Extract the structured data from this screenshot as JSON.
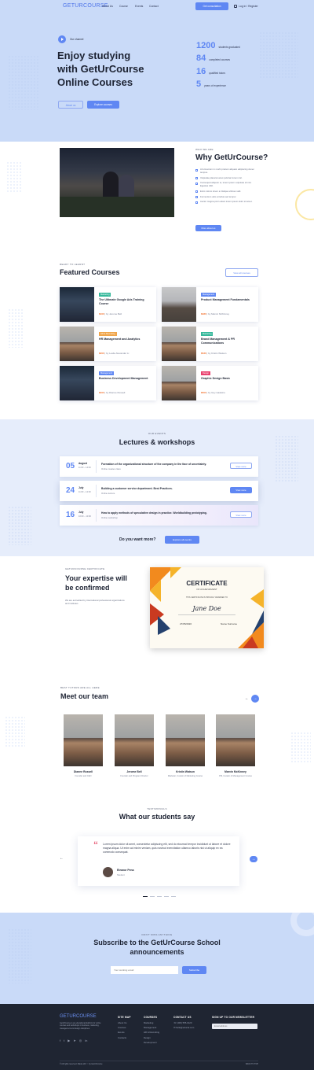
{
  "nav": {
    "logo": "GETURCOURSE",
    "links": [
      "About Us",
      "Course",
      "Events",
      "Contact"
    ],
    "cta": "Get consultation",
    "auth": "Log in / Register"
  },
  "hero": {
    "badge": "Our channel",
    "title_l1": "Enjoy studying",
    "title_l2": "with GetUrCourse",
    "title_l3": "Online Courses",
    "btn_secondary": "About us",
    "btn_primary": "Explore courses",
    "stats": [
      {
        "value": "1200",
        "label": "students graduated"
      },
      {
        "value": "84",
        "label": "completed courses"
      },
      {
        "value": "16",
        "label": "qualified tutors"
      },
      {
        "value": "5",
        "label": "years of experience"
      }
    ]
  },
  "why": {
    "eyebrow": "WHO WE ARE",
    "title": "Why GetUrCourse?",
    "items": [
      "A fermentum in morbi pretium aliquam adipiscing donec tempus.",
      "Vulputate placerat amet pulvinar lorem nisl.",
      "Consequat aliquam et, lorem ipsum vulputate sit nisi. Egestas nibh.",
      "Enim rutrum lorem a tristique ultrices velit.",
      "Fermentum odio at tellus sed tempor.",
      "Auctor magna proin etiam lorem ipsum dolor sit amet."
    ],
    "btn": "More about us"
  },
  "featured": {
    "eyebrow": "READY TO LEARN?",
    "title": "Featured Courses",
    "view_all": "View all courses",
    "courses": [
      {
        "tag": "Marketing",
        "tag_color": "#35b89b",
        "title": "The Ultimate Google Ads Training Course",
        "price": "$100",
        "author": "by Jerome Bell"
      },
      {
        "tag": "Management",
        "tag_color": "#5f87f3",
        "title": "Product Management Fundamentals",
        "price": "$480",
        "author": "by Marvin McKinney"
      },
      {
        "tag": "HR & Recruiting",
        "tag_color": "#f0a54a",
        "title": "HR Management and Analytics",
        "price": "$200",
        "author": "by Leslie Alexander Li"
      },
      {
        "tag": "Marketing",
        "tag_color": "#35b89b",
        "title": "Brand Management & PR Communications",
        "price": "$530",
        "author": "by Kristin Watson"
      },
      {
        "tag": "Management",
        "tag_color": "#5f87f3",
        "title": "Business Development Management",
        "price": "$400",
        "author": "by Dianne Russell"
      },
      {
        "tag": "Design",
        "tag_color": "#e9406e",
        "title": "Graphic Design Basic",
        "price": "$500",
        "author": "by Guy Hawkins"
      }
    ]
  },
  "events": {
    "eyebrow": "OUR EVENTS",
    "title": "Lectures & workshops",
    "items": [
      {
        "day": "05",
        "month": "August",
        "time": "11:00 – 14:00",
        "title": "Formation of the organizational structure of the company in the face of uncertainty.",
        "sub": "Online master-class",
        "btn": "View more"
      },
      {
        "day": "24",
        "month": "July",
        "time": "11:00 – 12:30",
        "title": "Building a customer service department. Best Practices.",
        "sub": "Online lecture",
        "btn": "View more"
      },
      {
        "day": "16",
        "month": "July",
        "time": "10:00 – 13:00",
        "title": "How to apply methods of speculative design in practice. Worldbuilding prototyping.",
        "sub": "Online workshop",
        "btn": "View more"
      }
    ],
    "more_q": "Do you want more?",
    "more_btn": "Explore all events"
  },
  "cert": {
    "eyebrow": "GETURCOURSE CERTIFICATE",
    "title_l1": "Your expertise will",
    "title_l2": "be confirmed",
    "desc": "We are accredited by international professional organizations and institutes",
    "c_title": "CERTIFICATE",
    "c_sub": "OF ACHIEVEMENT",
    "c_awarded": "THIS CERTIFICATE IS PROUDLY AWARDED TO",
    "c_name": "Jane Doe",
    "c_date": "27/05/2020",
    "c_sign": "Name Surname"
  },
  "team": {
    "eyebrow": "BEST TUTORS ARE ALL HERE",
    "title": "Meet our team",
    "members": [
      {
        "name": "Dianne Russell",
        "role": "Founder and CEO"
      },
      {
        "name": "Jerome Bell",
        "role": "Founder and Program Director"
      },
      {
        "name": "Kristin Watson",
        "role": "Marketer, Curator of Marketing Course"
      },
      {
        "name": "Marvin McKinney",
        "role": "PM, Curator of Management Course"
      }
    ]
  },
  "testimonials": {
    "eyebrow": "TESTIMONIALS",
    "title": "What our students say",
    "quote": "Lorem ipsum dolor sit amet, consectetur adipiscing elit, sed do eiusmod tempor incididunt ut labore et dolore magna aliqua. Ut enim ad minim veniam, quis nostrud exercitation ullamco laboris nisi ut aliquip ex ea commodo consequat.",
    "name": "Eleanor Pena",
    "role": "Student"
  },
  "subscribe": {
    "eyebrow": "DON'T MISS ANYTHING",
    "title_l1": "Subscribe to the GetUrCourse School",
    "title_l2": "announcements",
    "placeholder": "Your working email",
    "btn": "Subscribe"
  },
  "footer": {
    "logo": "GETURCOURSE",
    "about": "GetUrCourse is an educational platform for online courses and workshops in business, marketing, management and design disciplines.",
    "sitemap_h": "SITE MAP",
    "sitemap": [
      "About Us",
      "Courses",
      "Events",
      "Contacts"
    ],
    "courses_h": "COURSES",
    "courses": [
      "Marketing",
      "Management",
      "HR & Recruiting",
      "Design",
      "Development"
    ],
    "contact_h": "CONTACT US",
    "phone": "(406) 555-0120",
    "email": "hello@educat.com",
    "news_h": "SIGN UP TO OUR NEWSLETTER",
    "news_placeholder": "Email address",
    "copyright": "© All rights reserved. Made with ♡ by GetUrCourse",
    "back": "BACK TO TOP"
  }
}
